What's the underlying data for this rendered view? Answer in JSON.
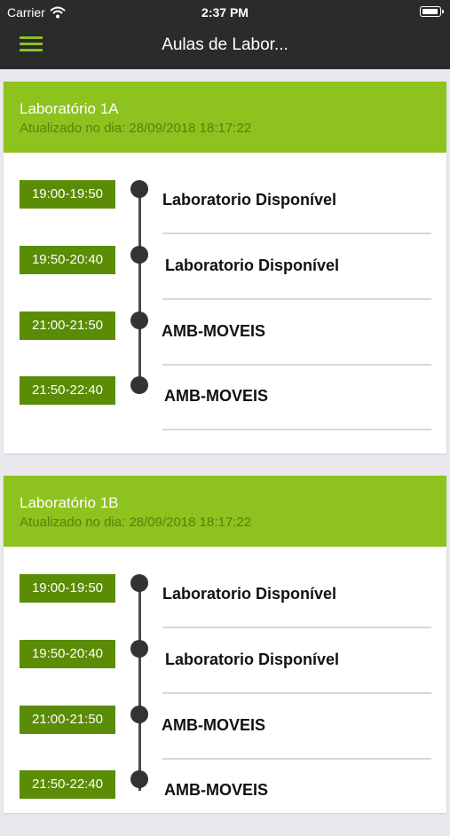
{
  "status_bar": {
    "carrier": "Carrier",
    "time": "2:37 PM"
  },
  "nav": {
    "title": "Aulas de Labor..."
  },
  "theme": {
    "accent": "#8dc21f",
    "chip": "#5a8c05",
    "bar": "#2b2b2b"
  },
  "labs": [
    {
      "title": "Laboratório 1A",
      "updated": "Atualizado no dia: 28/09/2018 18:17:22",
      "slots": [
        {
          "time": "19:00-19:50",
          "label": "Laboratorio Disponível"
        },
        {
          "time": "19:50-20:40",
          "label": "Laboratorio Disponível"
        },
        {
          "time": "21:00-21:50",
          "label": "AMB-MOVEIS"
        },
        {
          "time": "21:50-22:40",
          "label": "AMB-MOVEIS"
        }
      ]
    },
    {
      "title": "Laboratório 1B",
      "updated": "Atualizado no dia: 28/09/2018 18:17:22",
      "slots": [
        {
          "time": "19:00-19:50",
          "label": "Laboratorio Disponível"
        },
        {
          "time": "19:50-20:40",
          "label": "Laboratorio Disponível"
        },
        {
          "time": "21:00-21:50",
          "label": "AMB-MOVEIS"
        },
        {
          "time": "21:50-22:40",
          "label": "AMB-MOVEIS"
        }
      ]
    }
  ]
}
